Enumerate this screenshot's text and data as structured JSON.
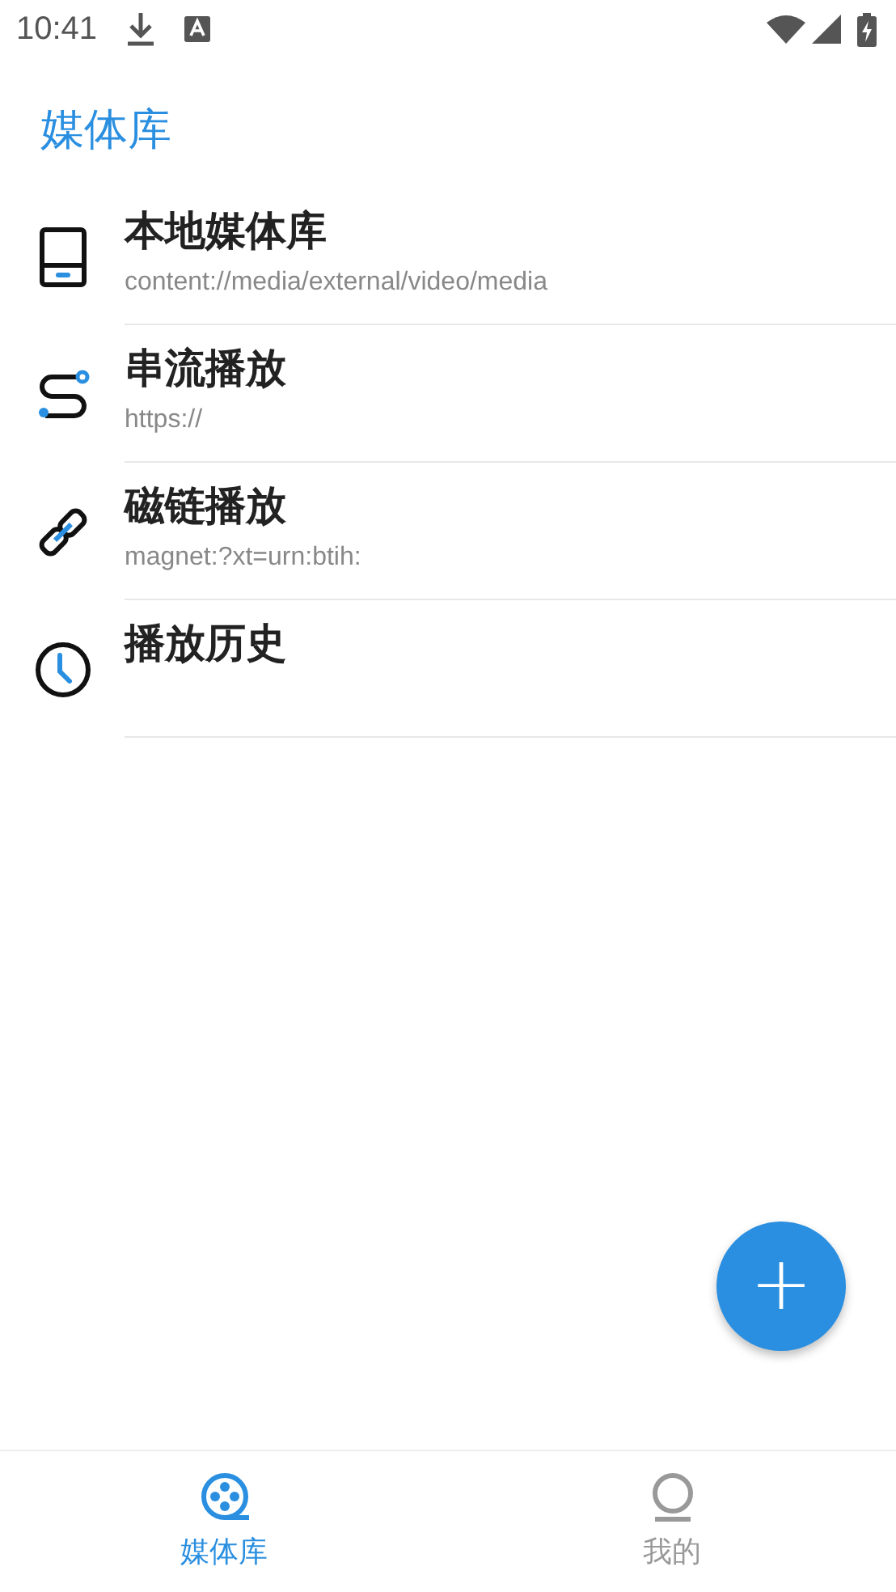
{
  "status_bar": {
    "time": "10:41"
  },
  "header": {
    "title": "媒体库"
  },
  "items": [
    {
      "kind": "drive",
      "title": "本地媒体库",
      "subtitle": "content://media/external/video/media"
    },
    {
      "kind": "stream",
      "title": "串流播放",
      "subtitle": "https://"
    },
    {
      "kind": "link",
      "title": "磁链播放",
      "subtitle": "magnet:?xt=urn:btih:"
    },
    {
      "kind": "clock",
      "title": "播放历史"
    }
  ],
  "fab": {
    "label": "+"
  },
  "bottom_nav": [
    {
      "kind": "reel",
      "label": "媒体库",
      "selected": true
    },
    {
      "kind": "person",
      "label": "我的",
      "selected": false
    }
  ]
}
